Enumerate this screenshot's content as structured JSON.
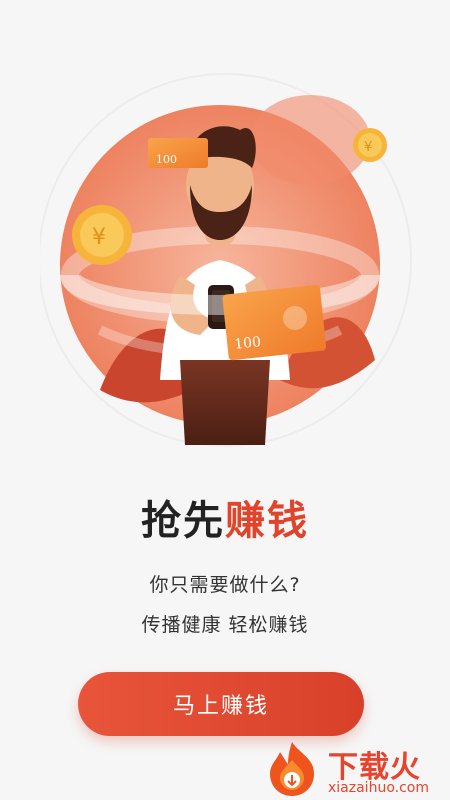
{
  "headline": {
    "part1": "抢先",
    "part2": "赚钱"
  },
  "subtitle": {
    "line1": "你只需要做什么?",
    "line2": "传播健康 轻松赚钱"
  },
  "cta": {
    "label": "马上赚钱"
  },
  "illustration": {
    "banknote_top": "100",
    "banknote_bottom": "100"
  },
  "watermark": {
    "brand_cn": "下载火",
    "brand_en": "xiazaihuo.com"
  },
  "colors": {
    "accent": "#e0442b",
    "button": "#e04b31",
    "background": "#f6f6f6"
  },
  "icons": [
    "yuan-coin-icon",
    "banknote-icon",
    "phone-icon",
    "flame-logo-icon"
  ]
}
